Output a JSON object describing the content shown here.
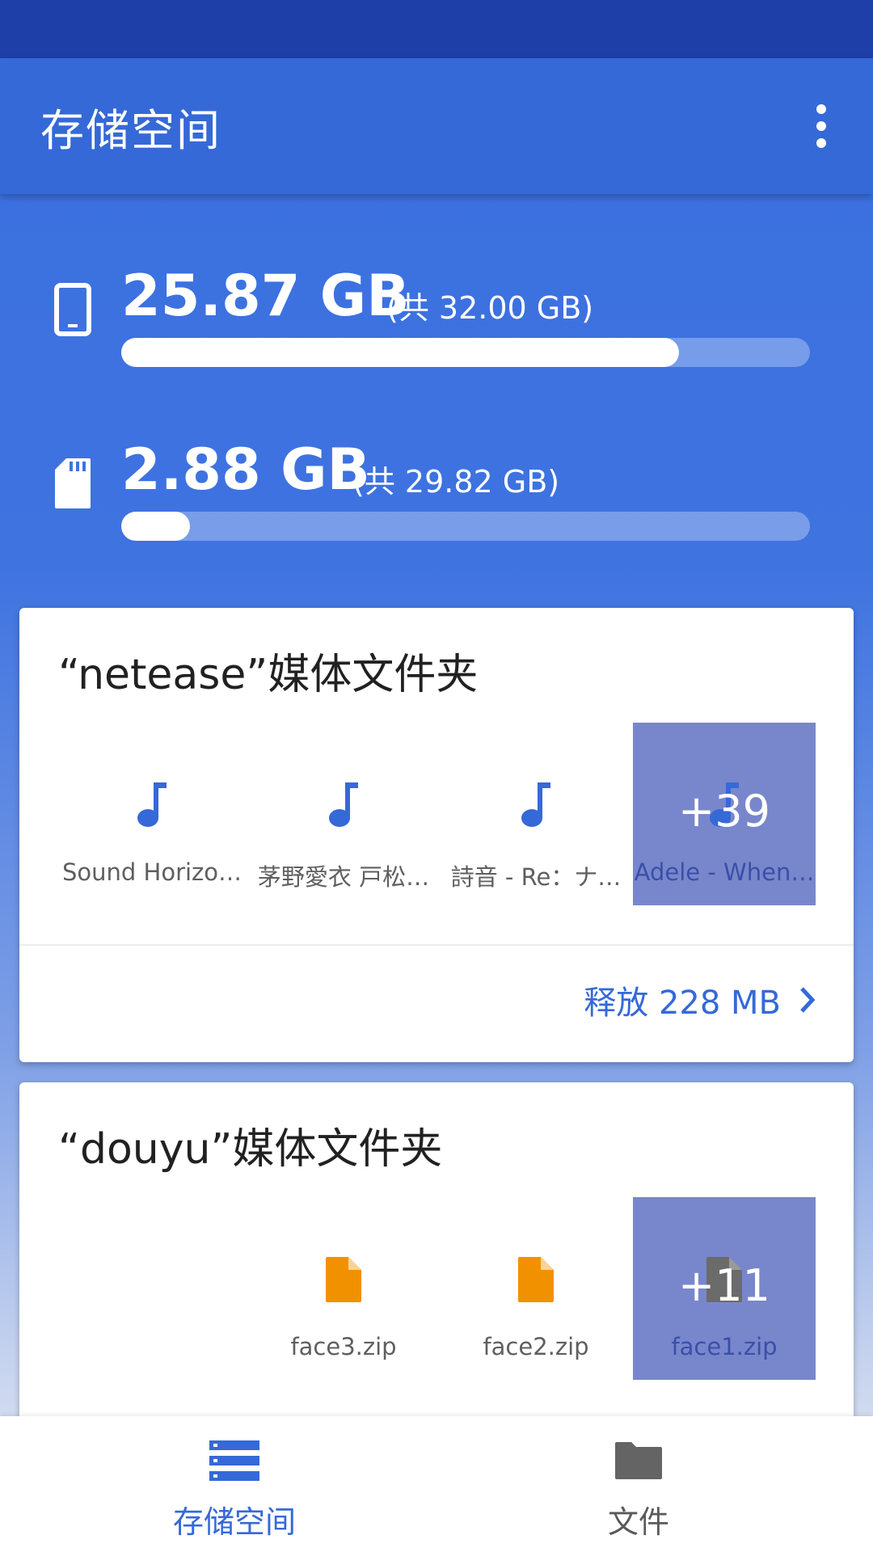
{
  "app_bar": {
    "title": "存储空间",
    "menu_icon": "more-vert-icon"
  },
  "storage": [
    {
      "icon": "phone-icon",
      "used": "25.87 GB",
      "total": "(共 32.00 GB)",
      "fraction": 0.81
    },
    {
      "icon": "sd-card-icon",
      "used": "2.88 GB",
      "total": "(共 29.82 GB)",
      "fraction": 0.1
    }
  ],
  "cards": [
    {
      "title": "“netease”媒体文件夹",
      "items": [
        {
          "icon": "music-note-icon",
          "label": "Sound Horizo…"
        },
        {
          "icon": "music-note-icon",
          "label": "茅野愛衣 戸松…"
        },
        {
          "icon": "music-note-icon",
          "label": "詩音 - Re：ナ…"
        }
      ],
      "more": {
        "count": "+39",
        "label": "Adele - When…"
      },
      "action": "释放 228 MB"
    },
    {
      "title": "“douyu”媒体文件夹",
      "items": [
        {
          "icon": "file-icon",
          "label": "face3.zip"
        },
        {
          "icon": "file-icon",
          "label": "face2.zip"
        }
      ],
      "more": {
        "count": "+11",
        "label": "face1.zip"
      }
    }
  ],
  "bottom_nav": [
    {
      "icon": "storage-icon",
      "label": "存储空间",
      "active": true
    },
    {
      "icon": "folder-icon",
      "label": "文件",
      "active": false
    }
  ],
  "colors": {
    "primary": "#3569d8",
    "status_bar": "#1e3fa8",
    "file_orange": "#f29100",
    "more_tile": "#7887cc"
  }
}
